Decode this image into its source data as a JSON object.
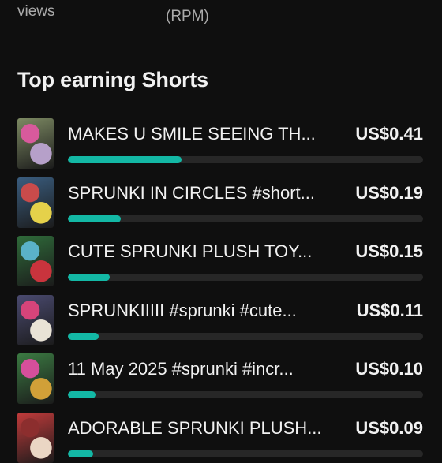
{
  "header": {
    "views_label": "views",
    "rpm_label": "(RPM)"
  },
  "section": {
    "title": "Top earning Shorts"
  },
  "shorts": [
    {
      "title": "MAKES U SMILE SEEING TH...",
      "amount": "US$0.41",
      "value": 0.41,
      "thumb_colors": [
        "#7d8a63",
        "#b6a0c9",
        "#d85a9c"
      ]
    },
    {
      "title": "SPRUNKI IN CIRCLES #short...",
      "amount": "US$0.19",
      "value": 0.19,
      "thumb_colors": [
        "#3a5d7f",
        "#e5d14a",
        "#c94b4b"
      ]
    },
    {
      "title": "CUTE SPRUNKI PLUSH TOY...",
      "amount": "US$0.15",
      "value": 0.15,
      "thumb_colors": [
        "#2f6b3a",
        "#c9343d",
        "#5ab2c8"
      ]
    },
    {
      "title": "SPRUNKIIIII #sprunki #cute...",
      "amount": "US$0.11",
      "value": 0.11,
      "thumb_colors": [
        "#4a4a70",
        "#e9e3d6",
        "#d6447a"
      ]
    },
    {
      "title": "11 May 2025 #sprunki #incr...",
      "amount": "US$0.10",
      "value": 0.1,
      "thumb_colors": [
        "#3b7a42",
        "#d1a038",
        "#d64f9b"
      ]
    },
    {
      "title": "ADORABLE SPRUNKI PLUSH...",
      "amount": "US$0.09",
      "value": 0.09,
      "thumb_colors": [
        "#c23b3b",
        "#ead6c4",
        "#8c2e2e"
      ]
    }
  ],
  "accent_color": "#13b8a5",
  "track_color": "#272727"
}
